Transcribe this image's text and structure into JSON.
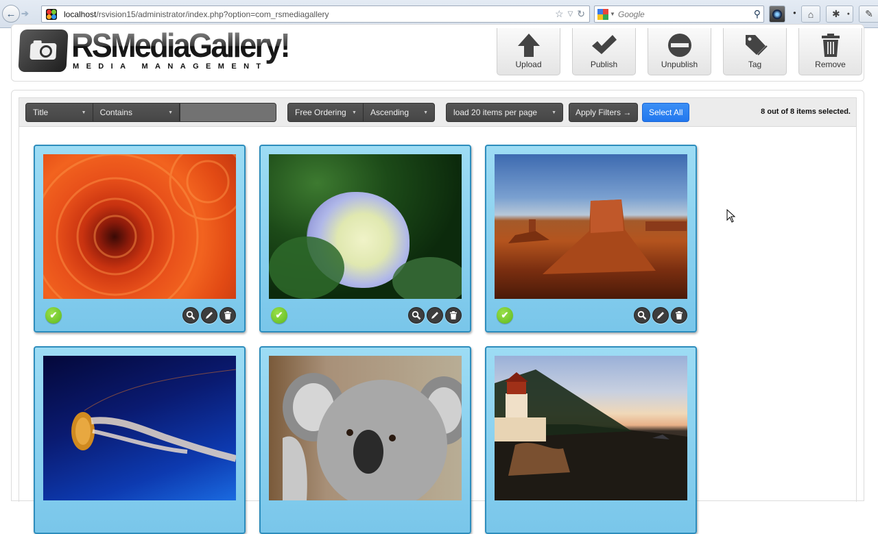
{
  "browser": {
    "url_host": "localhost",
    "url_path": "/rsvision15/administrator/index.php?option=com_rsmediagallery",
    "search_placeholder": "Google",
    "icons": [
      "back-arrow-icon",
      "forward-arrow-icon",
      "joomla-site-icon",
      "bookmark-star-icon",
      "dropdown-icon",
      "reload-icon",
      "google-icon",
      "search-icon",
      "addon-icon",
      "home-icon",
      "extension-icon",
      "pen-icon"
    ]
  },
  "header": {
    "logo_title": "RSMediaGallery!",
    "logo_subtitle": "MEDIA MANAGEMENT",
    "toolbar": [
      {
        "label": "Upload",
        "icon": "upload-arrow-icon"
      },
      {
        "label": "Publish",
        "icon": "checkmark-icon"
      },
      {
        "label": "Unpublish",
        "icon": "no-entry-icon"
      },
      {
        "label": "Tag",
        "icon": "tag-icon"
      },
      {
        "label": "Remove",
        "icon": "trash-icon"
      }
    ]
  },
  "filters": {
    "field": "Title",
    "condition": "Contains",
    "search_value": "",
    "ordering": "Free Ordering",
    "direction": "Ascending",
    "per_page": "load 20 items per page",
    "apply_label": "Apply Filters →",
    "select_all_label": "Select All",
    "selection_status": "8 out of 8 items selected."
  },
  "gallery": {
    "items": [
      {
        "subject": "orange chrysanthemum",
        "published": true
      },
      {
        "subject": "hydrangea",
        "published": true
      },
      {
        "subject": "desert butte",
        "published": true
      },
      {
        "subject": "jellyfish",
        "published": null
      },
      {
        "subject": "koala",
        "published": null
      },
      {
        "subject": "lighthouse",
        "published": null
      }
    ],
    "actions": [
      "preview",
      "edit",
      "delete"
    ]
  },
  "colors": {
    "card_bg": "#8fd3f1",
    "card_border": "#2d8dbd",
    "published_green": "#6cc62a",
    "select_all_blue": "#2a80f0",
    "filter_dark": "#4d4d4d"
  }
}
